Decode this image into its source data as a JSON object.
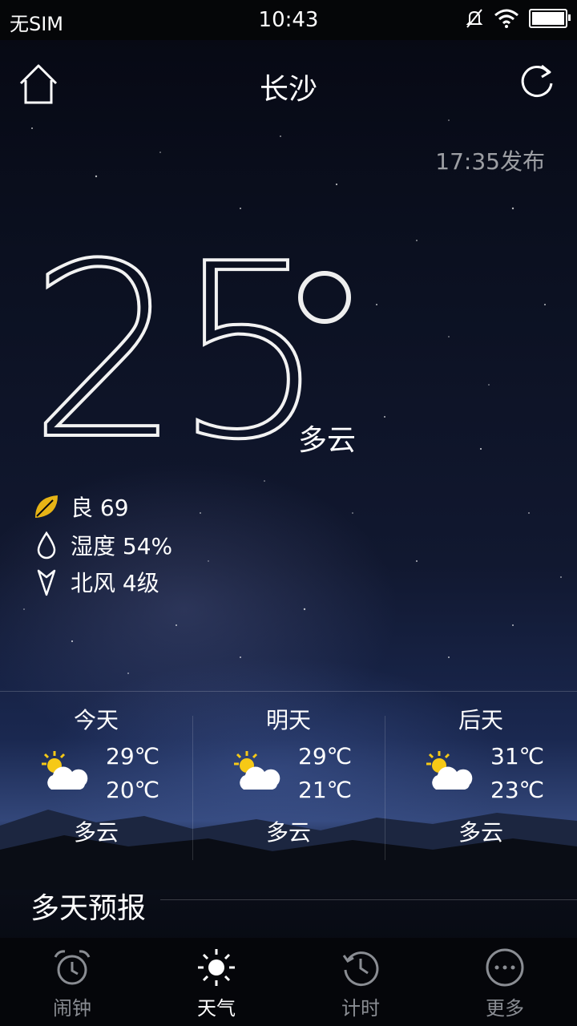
{
  "status_bar": {
    "carrier": "无SIM",
    "time": "10:43"
  },
  "header": {
    "city": "长沙"
  },
  "publish_time": "17:35发布",
  "current": {
    "temperature": "25",
    "condition": "多云",
    "air_quality": "良 69",
    "humidity": "湿度 54%",
    "wind": "北风 4级"
  },
  "days": [
    {
      "name": "今天",
      "high": "29℃",
      "low": "20℃",
      "condition": "多云"
    },
    {
      "name": "明天",
      "high": "29℃",
      "low": "21℃",
      "condition": "多云"
    },
    {
      "name": "后天",
      "high": "31℃",
      "low": "23℃",
      "condition": "多云"
    }
  ],
  "forecast_title": "多天预报",
  "tabs": [
    {
      "label": "闹钟",
      "icon": "alarm-clock-icon"
    },
    {
      "label": "天气",
      "icon": "sun-icon"
    },
    {
      "label": "计时",
      "icon": "history-timer-icon"
    },
    {
      "label": "更多",
      "icon": "more-dots-icon"
    }
  ],
  "colors": {
    "leaf": "#e7b416",
    "sun": "#f6c916",
    "active_tab": "#ffffff",
    "inactive_tab": "#8a8d93"
  }
}
